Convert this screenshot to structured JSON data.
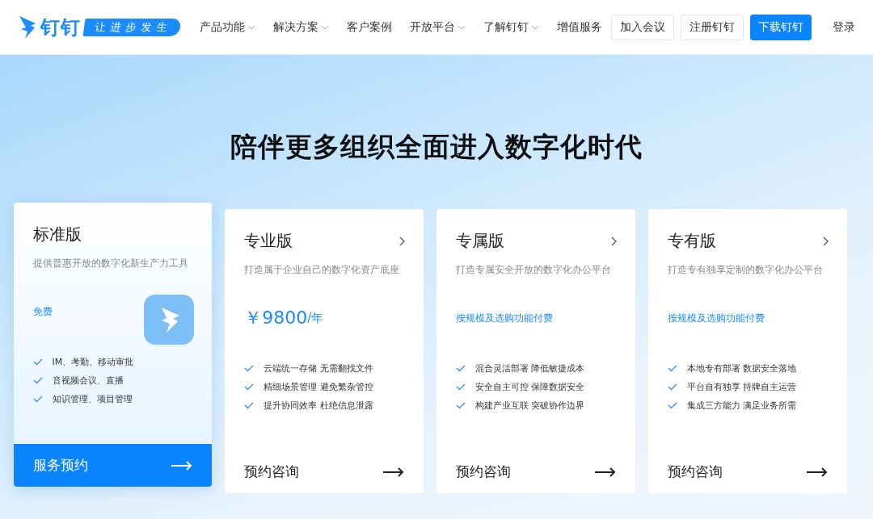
{
  "brand": {
    "name": "钉钉",
    "slogan": "让进步发生"
  },
  "nav": [
    {
      "label": "产品功能",
      "dropdown": true
    },
    {
      "label": "解决方案",
      "dropdown": true
    },
    {
      "label": "客户案例",
      "dropdown": false
    },
    {
      "label": "开放平台",
      "dropdown": true
    },
    {
      "label": "了解钉钉",
      "dropdown": true
    },
    {
      "label": "增值服务",
      "dropdown": false
    }
  ],
  "actions": [
    {
      "label": "加入会议",
      "kind": "outline"
    },
    {
      "label": "注册钉钉",
      "kind": "outline"
    },
    {
      "label": "下载钉钉",
      "kind": "primary"
    },
    {
      "label": "登录",
      "kind": "text"
    }
  ],
  "headline": "陪伴更多组织全面进入数字化时代",
  "plans": [
    {
      "name": "标准版",
      "selected": true,
      "subtitle": "提供普惠开放的数字化新生产力工具",
      "price": {
        "kind": "small",
        "text": "免费"
      },
      "features": [
        "IM、考勤、移动审批",
        "音视频会议、直播",
        "知识管理、项目管理"
      ],
      "cta": "服务预约"
    },
    {
      "name": "专业版",
      "selected": false,
      "subtitle": "打造属于企业自己的数字化资产底座",
      "price": {
        "kind": "big",
        "text": "￥9800",
        "unit": "/年"
      },
      "features": [
        "云端统一存储 无需翻找文件",
        "精细场景管理 避免繁杂管控",
        "提升协同效率 杜绝信息泄露"
      ],
      "cta": "预约咨询"
    },
    {
      "name": "专属版",
      "selected": false,
      "subtitle": "打造专属安全开放的数字化办公平台",
      "price": {
        "kind": "small",
        "text": "按规模及选购功能付费"
      },
      "features": [
        "混合灵活部署 降低敏捷成本",
        "安全自主可控 保障数据安全",
        "构建产业互联 突破协作边界"
      ],
      "cta": "预约咨询"
    },
    {
      "name": "专有版",
      "selected": false,
      "subtitle": "打造专有独享定制的数字化办公平台",
      "price": {
        "kind": "small",
        "text": "按规模及选购功能付费"
      },
      "features": [
        "本地专有部署 数据安全落地",
        "平台自有独享 持牌自主运营",
        "集成三方能力 满足业务所需"
      ],
      "cta": "预约咨询"
    }
  ]
}
